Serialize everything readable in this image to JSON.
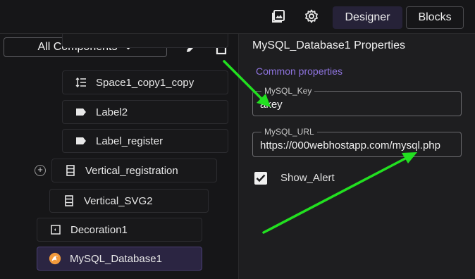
{
  "toolbar": {
    "image_icon": "image-icon",
    "settings_icon": "gear-icon",
    "designer_label": "Designer",
    "blocks_label": "Blocks"
  },
  "components": {
    "filter_label": "All Components",
    "items": [
      {
        "label": "Space1_copy1_copy",
        "icon": "spacer-icon"
      },
      {
        "label": "Label2",
        "icon": "label-icon"
      },
      {
        "label": "Label_register",
        "icon": "label-icon"
      },
      {
        "label": "Vertical_registration",
        "icon": "vertical-layout-icon"
      },
      {
        "label": "Vertical_SVG2",
        "icon": "vertical-layout-icon"
      },
      {
        "label": "Decoration1",
        "icon": "decoration-icon"
      },
      {
        "label": "MySQL_Database1",
        "icon": "mysql-icon"
      }
    ]
  },
  "properties": {
    "title": "MySQL_Database1 Properties",
    "section": "Common properties",
    "fields": [
      {
        "label": "MySQL_Key",
        "value": "akey"
      },
      {
        "label": "MySQL_URL",
        "value": "https://000webhostapp.com/mysql.php"
      }
    ],
    "checkbox": {
      "label": "Show_Alert",
      "checked": true
    }
  },
  "colors": {
    "accent": "#8f74e0",
    "selected_bg": "#2b2542",
    "annotation_arrow": "#22e020"
  }
}
